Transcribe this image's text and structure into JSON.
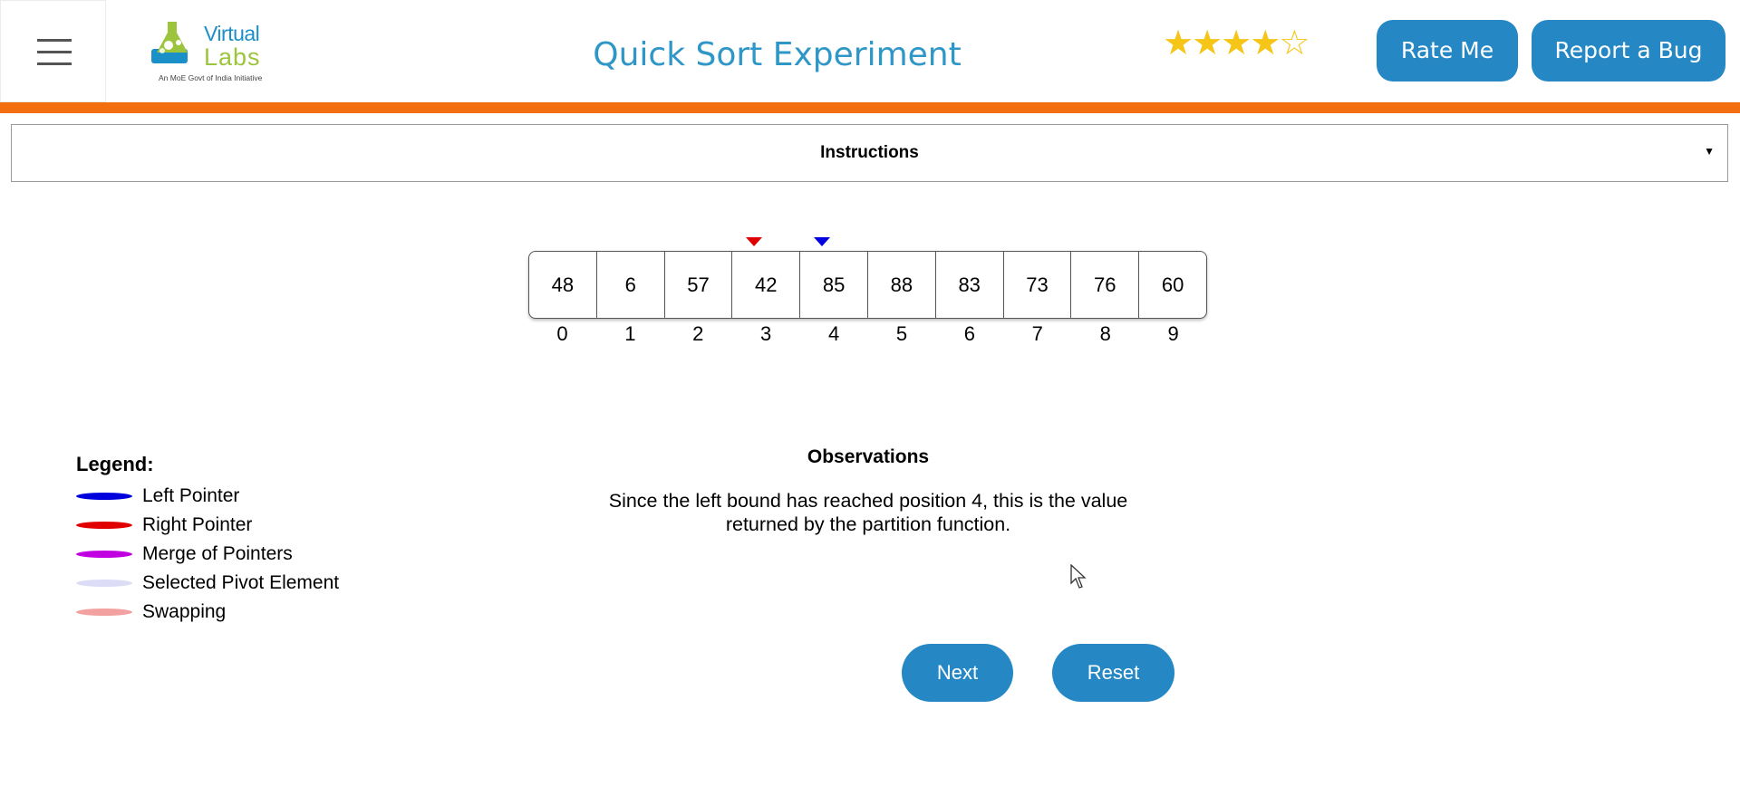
{
  "header": {
    "menu_icon": "hamburger-menu-icon",
    "logo": {
      "line1": "Virtual",
      "line2": "Labs",
      "tagline": "An MoE Govt of India Initiative"
    },
    "title": "Quick Sort Experiment",
    "rating": {
      "value": 4,
      "max": 5,
      "filled_star": "★",
      "empty_star": "☆"
    },
    "rate_label": "Rate Me",
    "bug_label": "Report a Bug"
  },
  "instructions": {
    "label": "Instructions",
    "caret": "▼"
  },
  "array": {
    "values": [
      "48",
      "6",
      "57",
      "42",
      "85",
      "88",
      "83",
      "73",
      "76",
      "60"
    ],
    "indices": [
      "0",
      "1",
      "2",
      "3",
      "4",
      "5",
      "6",
      "7",
      "8",
      "9"
    ],
    "right_pointer_index": 3,
    "left_pointer_index": 4
  },
  "legend": {
    "title": "Legend:",
    "items": [
      {
        "label": "Left Pointer",
        "color": "#0000dd"
      },
      {
        "label": "Right Pointer",
        "color": "#e00000"
      },
      {
        "label": "Merge of Pointers",
        "color": "#c000e0"
      },
      {
        "label": "Selected Pivot Element",
        "color": "#dcdcf6"
      },
      {
        "label": "Swapping",
        "color": "#f2a0a0"
      }
    ]
  },
  "observations": {
    "title": "Observations",
    "text": "Since the left bound has reached position 4, this is the value returned by the partition function."
  },
  "buttons": {
    "next_label": "Next",
    "reset_label": "Reset"
  },
  "colors": {
    "accent": "#2588c5",
    "orange_bar": "#f36e0e",
    "title": "#2f97c7",
    "star": "#f5c518"
  }
}
